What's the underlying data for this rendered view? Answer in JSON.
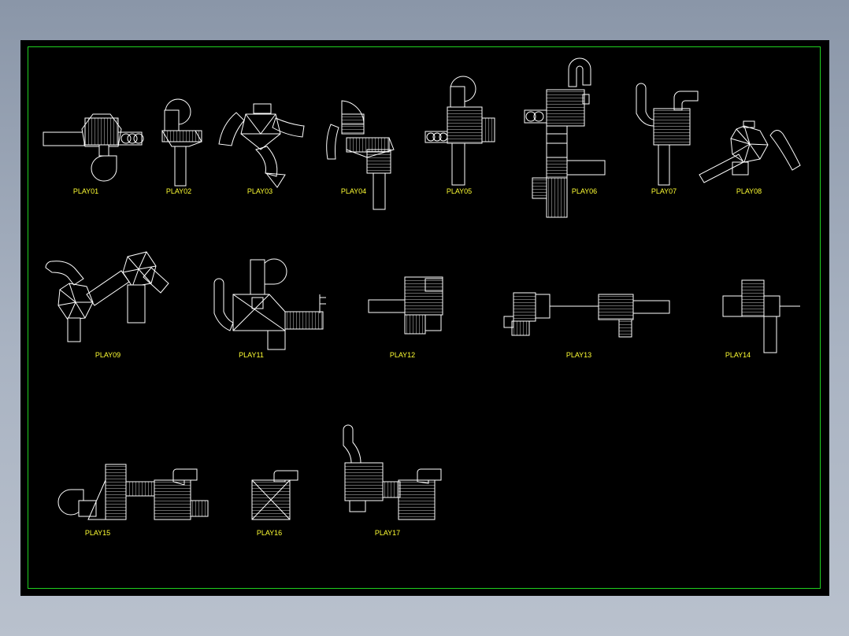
{
  "colors": {
    "sheet_background": "#000000",
    "frame_border": "#1fd11f",
    "linework": "#ffffff",
    "label_text": "#ffff33",
    "window_background": "#9aa5b5"
  },
  "labels": {
    "play01": "PLAY01",
    "play02": "PLAY02",
    "play03": "PLAY03",
    "play04": "PLAY04",
    "play05": "PLAY05",
    "play06": "PLAY06",
    "play07": "PLAY07",
    "play08": "PLAY08",
    "play09": "PLAY09",
    "play11": "PLAY11",
    "play12": "PLAY12",
    "play13": "PLAY13",
    "play14": "PLAY14",
    "play15": "PLAY15",
    "play16": "PLAY16",
    "play17": "PLAY17"
  }
}
